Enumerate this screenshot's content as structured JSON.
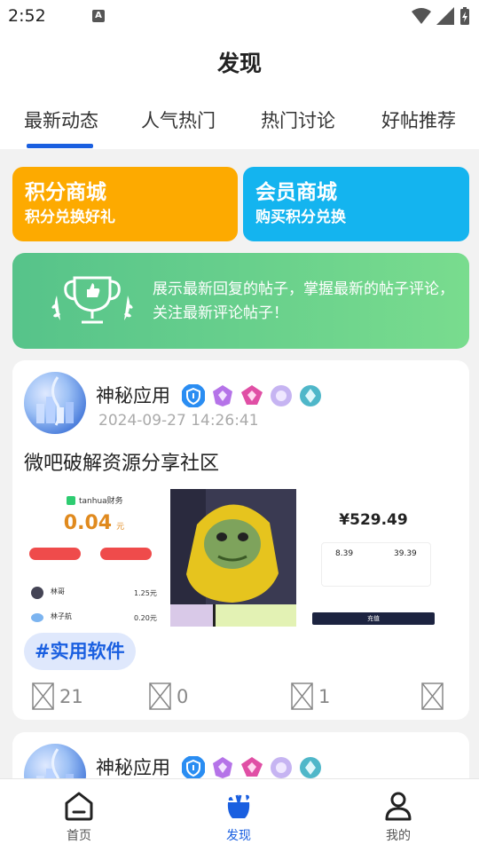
{
  "status_bar": {
    "time": "2:52",
    "notif_letter": "A"
  },
  "header": {
    "title": "发现",
    "tabs": [
      {
        "label": "最新动态",
        "active": true
      },
      {
        "label": "人气热门",
        "active": false
      },
      {
        "label": "热门讨论",
        "active": false
      },
      {
        "label": "好帖推荐",
        "active": false
      }
    ]
  },
  "promos": {
    "points_mall": {
      "title": "积分商城",
      "subtitle": "积分兑换好礼",
      "color": "#fdaa00"
    },
    "member_mall": {
      "title": "会员商城",
      "subtitle": "购买积分兑换",
      "color": "#14b4ef"
    }
  },
  "notice": {
    "text": "展示最新回复的帖子，掌握最新的帖子评论，关注最新评论帖子！",
    "icon": "trophy-icon"
  },
  "posts": [
    {
      "username": "神秘应用",
      "time": "2024-09-27 14:26:41",
      "content": "微吧破解资源分享社区",
      "topic": "#实用软件",
      "images": {
        "wallet": {
          "app_name": "tanhua财务",
          "amount": "0.04",
          "unit": "元",
          "rows": [
            {
              "name": "林哥",
              "value": "1.25元"
            },
            {
              "name": "林子航",
              "value": "0.20元"
            }
          ]
        },
        "balance": {
          "amount": "¥529.49",
          "left_value": "8.39",
          "right_value": "39.39",
          "button": "充值"
        }
      },
      "stats": {
        "views": "21",
        "likes": "0",
        "comments": "1"
      }
    },
    {
      "username": "神秘应用"
    }
  ],
  "bottom_nav": [
    {
      "label": "首页",
      "icon": "home-icon",
      "active": false
    },
    {
      "label": "发现",
      "icon": "discover-icon",
      "active": true
    },
    {
      "label": "我的",
      "icon": "user-icon",
      "active": false
    }
  ],
  "colors": {
    "accent": "#1a5fe0",
    "notice_green": "#5fcb8b"
  }
}
